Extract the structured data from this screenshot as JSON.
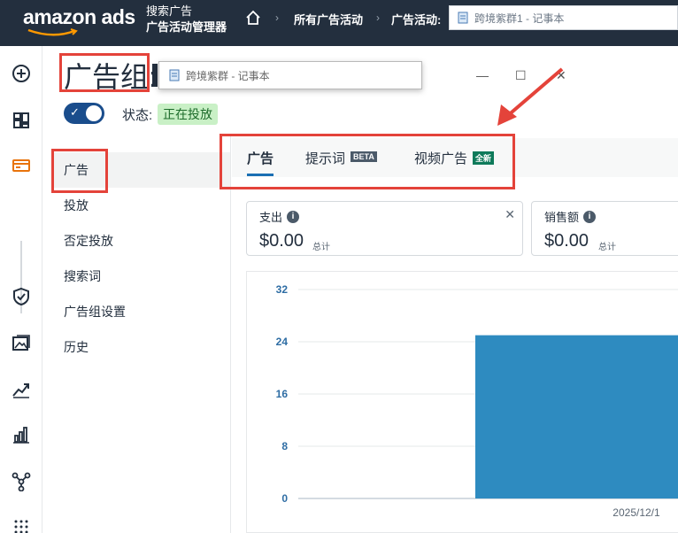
{
  "topbar": {
    "logo": "amazon ads",
    "product_line1": "搜索广告",
    "product_line2": "广告活动管理器",
    "breadcrumb_1": "所有广告活动",
    "breadcrumb_2": "广告活动:",
    "notepad_tab": "跨境紫群1 - 记事本"
  },
  "rail": {
    "icons": [
      "plus-circle-icon",
      "dashboard-icon",
      "campaign-card-icon",
      "shield-icon",
      "image-icon",
      "trend-icon",
      "bar-chart-icon",
      "network-icon",
      "apps-grid-icon"
    ]
  },
  "page": {
    "title": "广告组:",
    "status_label": "状态:",
    "status_value": "正在投放",
    "status_color": "#c9f0c6"
  },
  "notepad_window": {
    "title": "跨境紫群 - 记事本"
  },
  "sidenav": {
    "items": [
      "广告",
      "投放",
      "否定投放",
      "搜索词",
      "广告组设置",
      "历史"
    ]
  },
  "tabs": {
    "ads": "广告",
    "prompt_words": "提示词",
    "prompt_badge": "BETA",
    "video_ads": "视频广告",
    "video_badge": "全新"
  },
  "cards": {
    "spend_label": "支出",
    "spend_value": "$0.00",
    "spend_sub": "总计",
    "sales_label": "销售额",
    "sales_value": "$0.00",
    "sales_sub": "总计"
  },
  "chart_data": {
    "type": "bar",
    "categories": [
      "2025/12/1"
    ],
    "values": [
      25
    ],
    "title": "",
    "xlabel": "",
    "ylabel": "",
    "ylim": [
      0,
      32
    ],
    "yticks": [
      "32",
      "24",
      "16",
      "8",
      "0"
    ],
    "bar_color": "#2e8bc0",
    "grid": true
  },
  "colors": {
    "topbar": "#232f3e",
    "accent": "#1a6fb3",
    "highlight_box": "#e4433a"
  }
}
